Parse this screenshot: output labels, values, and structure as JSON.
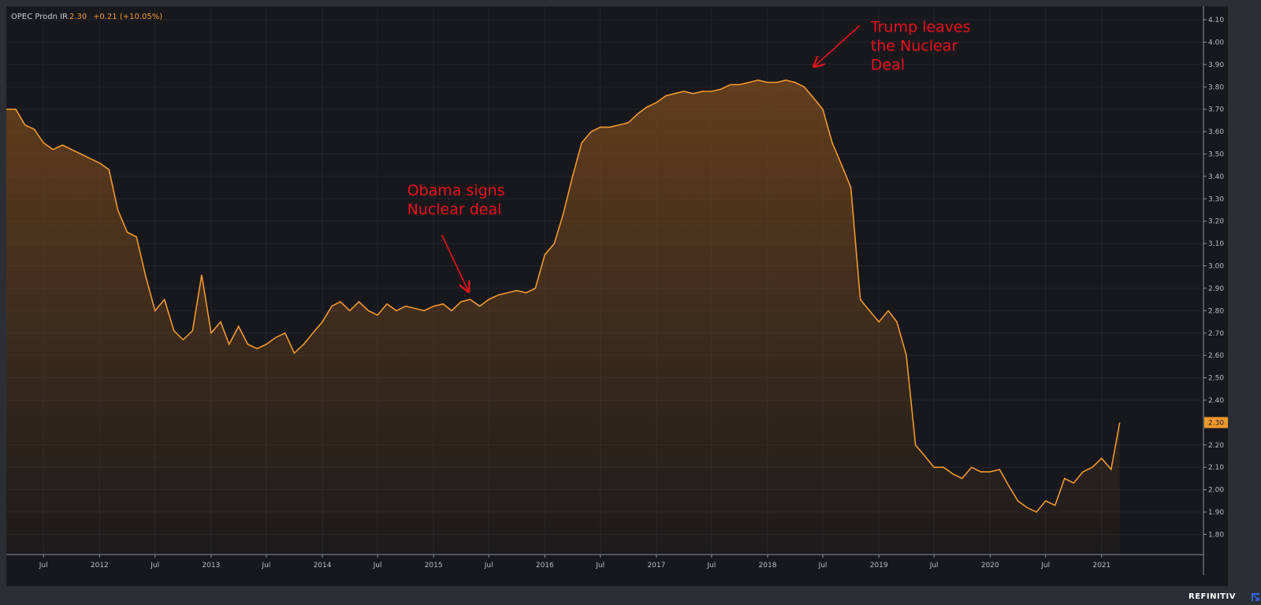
{
  "colors": {
    "line": "#f0982e",
    "fill_top": "#7a4a1d",
    "plot_bg": "#17181c",
    "annotation": "#e8121c",
    "tick_text": "#b6bcc5"
  },
  "legend": {
    "title": "OPEC Prodn IR",
    "value": "2.30",
    "change": "+0.21 (+10.05%)"
  },
  "brand": {
    "name": "REFINITIV",
    "icon": "refinitiv-arrow-icon"
  },
  "chart_data": {
    "type": "area",
    "title": "",
    "xlabel": "",
    "ylabel": "",
    "ylim": [
      1.71,
      4.16
    ],
    "xlim": [
      "2011-03-01",
      "2021-12-01"
    ],
    "grid": true,
    "y_axis_side": "right",
    "y_ticks": [
      "4.10",
      "4.00",
      "3.90",
      "3.80",
      "3.70",
      "3.60",
      "3.50",
      "3.40",
      "3.30",
      "3.20",
      "3.10",
      "3.00",
      "2.90",
      "2.80",
      "2.70",
      "2.60",
      "2.50",
      "2.40",
      "2.20",
      "2.10",
      "2.00",
      "1.90",
      "1.80"
    ],
    "x_ticks": [
      {
        "date": "2011-07-01",
        "label": "Jul"
      },
      {
        "date": "2012-01-01",
        "label": "2012"
      },
      {
        "date": "2012-07-01",
        "label": "Jul"
      },
      {
        "date": "2013-01-01",
        "label": "2013"
      },
      {
        "date": "2013-07-01",
        "label": "Jul"
      },
      {
        "date": "2014-01-01",
        "label": "2014"
      },
      {
        "date": "2014-07-01",
        "label": "Jul"
      },
      {
        "date": "2015-01-01",
        "label": "2015"
      },
      {
        "date": "2015-07-01",
        "label": "Jul"
      },
      {
        "date": "2016-01-01",
        "label": "2016"
      },
      {
        "date": "2016-07-01",
        "label": "Jul"
      },
      {
        "date": "2017-01-01",
        "label": "2017"
      },
      {
        "date": "2017-07-01",
        "label": "Jul"
      },
      {
        "date": "2018-01-01",
        "label": "2018"
      },
      {
        "date": "2018-07-01",
        "label": "Jul"
      },
      {
        "date": "2019-01-01",
        "label": "2019"
      },
      {
        "date": "2019-07-01",
        "label": "Jul"
      },
      {
        "date": "2020-01-01",
        "label": "2020"
      },
      {
        "date": "2020-07-01",
        "label": "Jul"
      },
      {
        "date": "2021-01-01",
        "label": "2021"
      }
    ],
    "last_value_label": "2.30",
    "series": [
      {
        "points": [
          [
            "2011-03-01",
            3.7
          ],
          [
            "2011-04-01",
            3.7
          ],
          [
            "2011-05-01",
            3.63
          ],
          [
            "2011-06-01",
            3.61
          ],
          [
            "2011-07-01",
            3.55
          ],
          [
            "2011-08-01",
            3.52
          ],
          [
            "2011-09-01",
            3.54
          ],
          [
            "2011-10-01",
            3.52
          ],
          [
            "2011-11-01",
            3.5
          ],
          [
            "2011-12-01",
            3.48
          ],
          [
            "2012-01-01",
            3.46
          ],
          [
            "2012-02-01",
            3.43
          ],
          [
            "2012-03-01",
            3.25
          ],
          [
            "2012-04-01",
            3.15
          ],
          [
            "2012-05-01",
            3.13
          ],
          [
            "2012-06-01",
            2.95
          ],
          [
            "2012-07-01",
            2.8
          ],
          [
            "2012-08-01",
            2.85
          ],
          [
            "2012-09-01",
            2.71
          ],
          [
            "2012-10-01",
            2.67
          ],
          [
            "2012-11-01",
            2.71
          ],
          [
            "2012-12-01",
            2.96
          ],
          [
            "2013-01-01",
            2.7
          ],
          [
            "2013-02-01",
            2.75
          ],
          [
            "2013-03-01",
            2.65
          ],
          [
            "2013-04-01",
            2.73
          ],
          [
            "2013-05-01",
            2.65
          ],
          [
            "2013-06-01",
            2.63
          ],
          [
            "2013-07-01",
            2.65
          ],
          [
            "2013-08-01",
            2.68
          ],
          [
            "2013-09-01",
            2.7
          ],
          [
            "2013-10-01",
            2.61
          ],
          [
            "2013-11-01",
            2.65
          ],
          [
            "2013-12-01",
            2.7
          ],
          [
            "2014-01-01",
            2.75
          ],
          [
            "2014-02-01",
            2.82
          ],
          [
            "2014-03-01",
            2.84
          ],
          [
            "2014-04-01",
            2.8
          ],
          [
            "2014-05-01",
            2.84
          ],
          [
            "2014-06-01",
            2.8
          ],
          [
            "2014-07-01",
            2.78
          ],
          [
            "2014-08-01",
            2.83
          ],
          [
            "2014-09-01",
            2.8
          ],
          [
            "2014-10-01",
            2.82
          ],
          [
            "2014-11-01",
            2.81
          ],
          [
            "2014-12-01",
            2.8
          ],
          [
            "2015-01-01",
            2.82
          ],
          [
            "2015-02-01",
            2.83
          ],
          [
            "2015-03-01",
            2.8
          ],
          [
            "2015-04-01",
            2.84
          ],
          [
            "2015-05-01",
            2.85
          ],
          [
            "2015-06-01",
            2.82
          ],
          [
            "2015-07-01",
            2.85
          ],
          [
            "2015-08-01",
            2.87
          ],
          [
            "2015-09-01",
            2.88
          ],
          [
            "2015-10-01",
            2.89
          ],
          [
            "2015-11-01",
            2.88
          ],
          [
            "2015-12-01",
            2.9
          ],
          [
            "2016-01-01",
            3.05
          ],
          [
            "2016-02-01",
            3.1
          ],
          [
            "2016-03-01",
            3.23
          ],
          [
            "2016-04-01",
            3.4
          ],
          [
            "2016-05-01",
            3.55
          ],
          [
            "2016-06-01",
            3.6
          ],
          [
            "2016-07-01",
            3.62
          ],
          [
            "2016-08-01",
            3.62
          ],
          [
            "2016-09-01",
            3.63
          ],
          [
            "2016-10-01",
            3.64
          ],
          [
            "2016-11-01",
            3.68
          ],
          [
            "2016-12-01",
            3.71
          ],
          [
            "2017-01-01",
            3.73
          ],
          [
            "2017-02-01",
            3.76
          ],
          [
            "2017-03-01",
            3.77
          ],
          [
            "2017-04-01",
            3.78
          ],
          [
            "2017-05-01",
            3.77
          ],
          [
            "2017-06-01",
            3.78
          ],
          [
            "2017-07-01",
            3.78
          ],
          [
            "2017-08-01",
            3.79
          ],
          [
            "2017-09-01",
            3.81
          ],
          [
            "2017-10-01",
            3.81
          ],
          [
            "2017-11-01",
            3.82
          ],
          [
            "2017-12-01",
            3.83
          ],
          [
            "2018-01-01",
            3.82
          ],
          [
            "2018-02-01",
            3.82
          ],
          [
            "2018-03-01",
            3.83
          ],
          [
            "2018-04-01",
            3.82
          ],
          [
            "2018-05-01",
            3.8
          ],
          [
            "2018-06-01",
            3.75
          ],
          [
            "2018-07-01",
            3.7
          ],
          [
            "2018-08-01",
            3.55
          ],
          [
            "2018-09-01",
            3.45
          ],
          [
            "2018-10-01",
            3.35
          ],
          [
            "2018-11-01",
            2.85
          ],
          [
            "2018-12-01",
            2.8
          ],
          [
            "2019-01-01",
            2.75
          ],
          [
            "2019-02-01",
            2.8
          ],
          [
            "2019-03-01",
            2.75
          ],
          [
            "2019-04-01",
            2.6
          ],
          [
            "2019-05-01",
            2.2
          ],
          [
            "2019-06-01",
            2.15
          ],
          [
            "2019-07-01",
            2.1
          ],
          [
            "2019-08-01",
            2.1
          ],
          [
            "2019-09-01",
            2.07
          ],
          [
            "2019-10-01",
            2.05
          ],
          [
            "2019-11-01",
            2.1
          ],
          [
            "2019-12-01",
            2.08
          ],
          [
            "2020-01-01",
            2.08
          ],
          [
            "2020-02-01",
            2.09
          ],
          [
            "2020-03-01",
            2.02
          ],
          [
            "2020-04-01",
            1.95
          ],
          [
            "2020-05-01",
            1.92
          ],
          [
            "2020-06-01",
            1.9
          ],
          [
            "2020-07-01",
            1.95
          ],
          [
            "2020-08-01",
            1.93
          ],
          [
            "2020-09-01",
            2.05
          ],
          [
            "2020-10-01",
            2.03
          ],
          [
            "2020-11-01",
            2.08
          ],
          [
            "2020-12-01",
            2.1
          ],
          [
            "2021-01-01",
            2.14
          ],
          [
            "2021-02-01",
            2.09
          ],
          [
            "2021-03-01",
            2.3
          ]
        ]
      }
    ],
    "annotations": [
      {
        "lines": [
          "Obama signs",
          "Nuclear deal"
        ],
        "date": "2015-05-01",
        "value": 2.85
      },
      {
        "lines": [
          "Trump leaves",
          "the Nuclear",
          "Deal"
        ],
        "date": "2018-04-01",
        "value": 3.82
      }
    ]
  }
}
